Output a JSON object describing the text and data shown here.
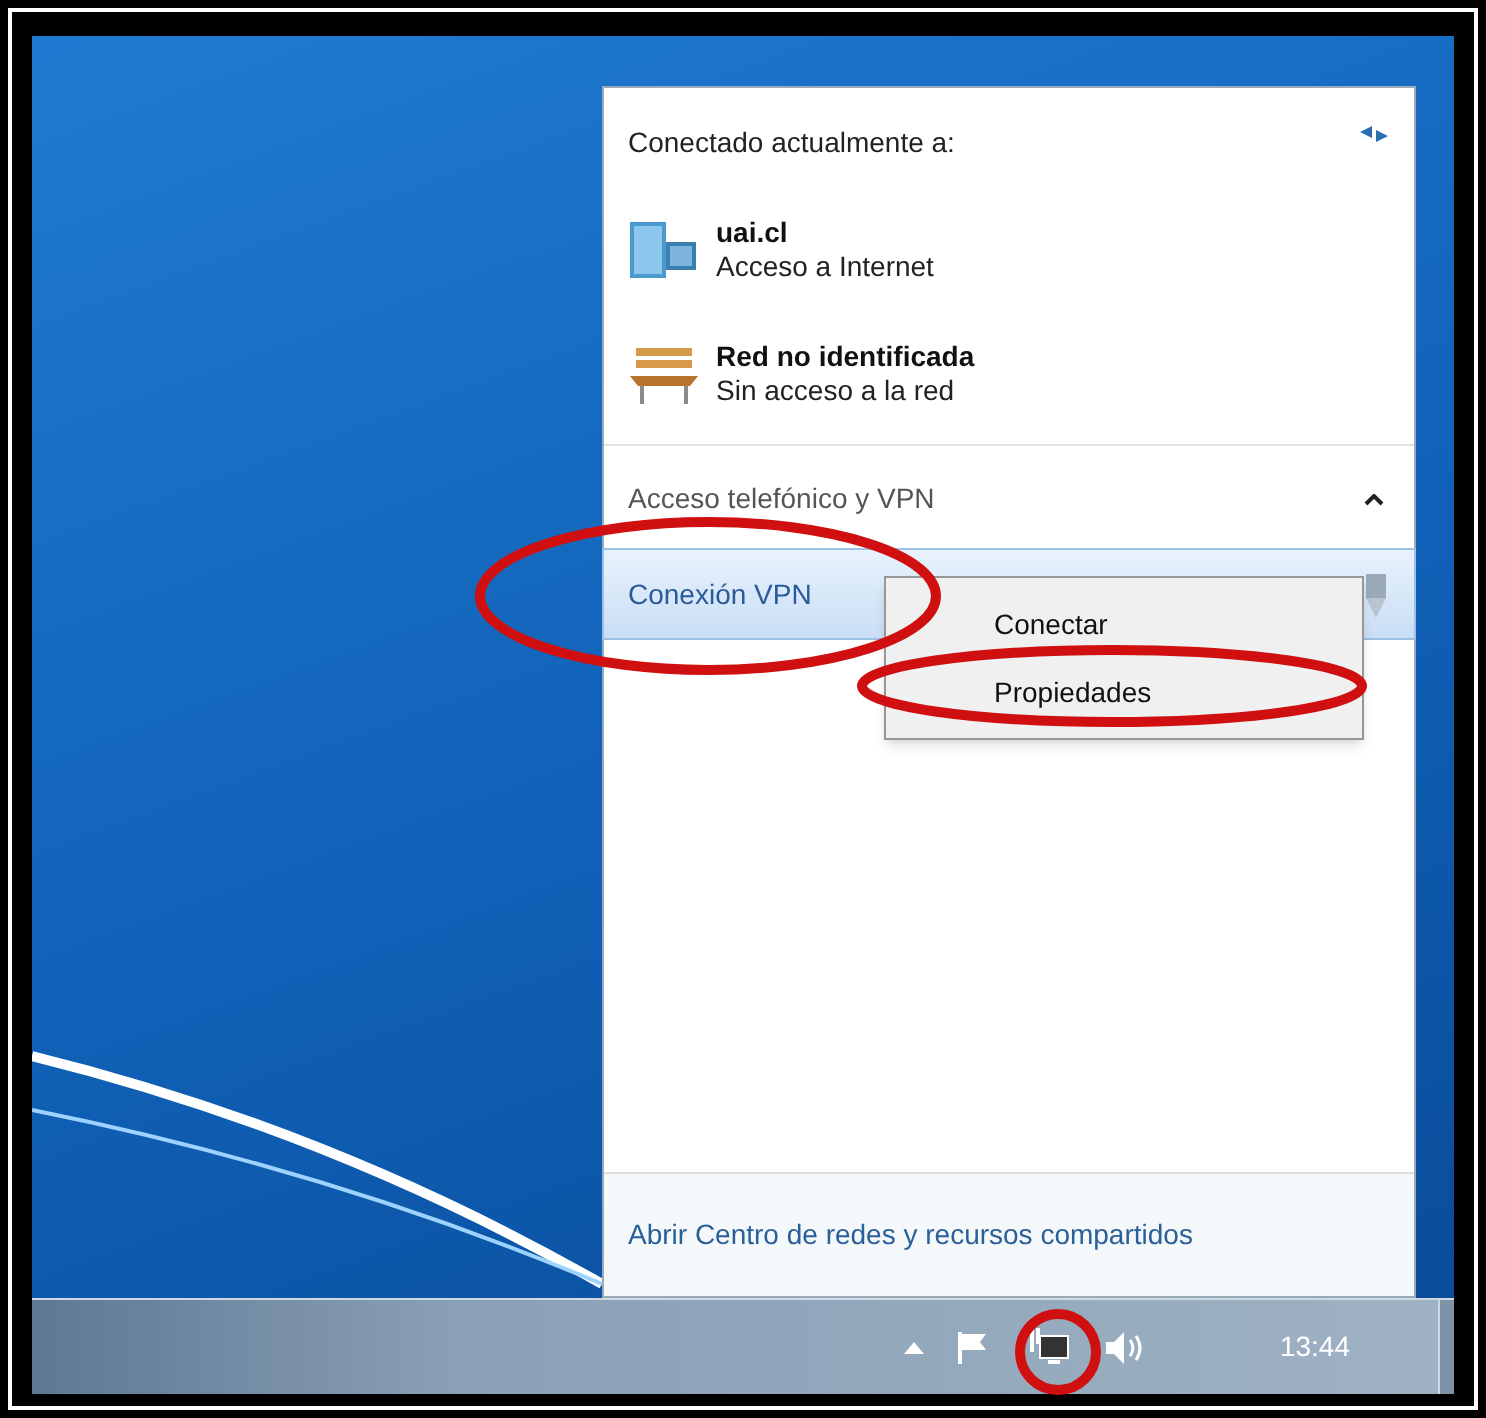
{
  "flyout": {
    "header": "Conectado actualmente a:",
    "connections": [
      {
        "kind": "domain",
        "name": "uai.cl",
        "status": "Acceso a Internet"
      },
      {
        "kind": "unidentified",
        "name": "Red no identificada",
        "status": "Sin acceso a la red"
      }
    ],
    "section": {
      "title": "Acceso telefónico y VPN",
      "expanded": true
    },
    "vpn_connections": [
      {
        "name": "Conexión VPN",
        "selected": true
      }
    ],
    "context_menu": [
      "Conectar",
      "Propiedades"
    ],
    "footer_link": "Abrir Centro de redes y recursos compartidos"
  },
  "taskbar": {
    "clock": "13:44"
  }
}
